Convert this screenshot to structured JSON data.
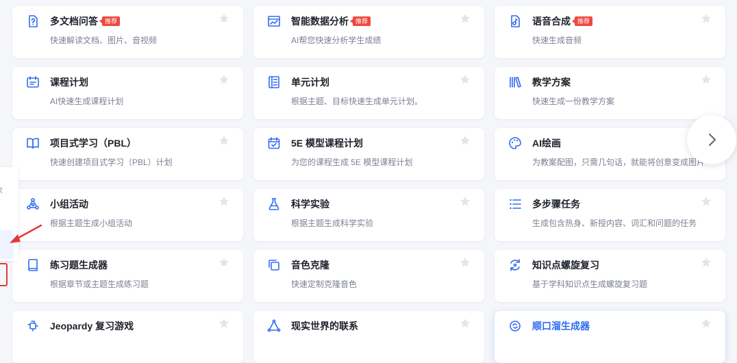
{
  "cards": [
    {
      "title": "多文档问答",
      "desc": "快速解读文档、图片、音视频",
      "badge": "推荐",
      "icon": "doc-question-icon"
    },
    {
      "title": "智能数据分析",
      "desc": "AI帮您快速分析学生成绩",
      "badge": "推荐",
      "icon": "data-chart-icon"
    },
    {
      "title": "语音合成",
      "desc": "快速生成音频",
      "badge": "推荐",
      "icon": "audio-file-icon"
    },
    {
      "title": "课程计划",
      "desc": "AI快速生成课程计划",
      "badge": "",
      "icon": "course-plan-icon"
    },
    {
      "title": "单元计划",
      "desc": "根据主题、目标快速生成单元计划。",
      "badge": "",
      "icon": "unit-plan-icon"
    },
    {
      "title": "教学方案",
      "desc": "快速生成一份教学方案",
      "badge": "",
      "icon": "books-icon"
    },
    {
      "title": "项目式学习（PBL）",
      "desc": "快速创建项目式学习（PBL）计划",
      "badge": "",
      "icon": "open-book-icon"
    },
    {
      "title": "5E 模型课程计划",
      "desc": "为您的课程生成 5E 模型课程计划",
      "badge": "",
      "icon": "calendar-check-icon"
    },
    {
      "title": "AI绘画",
      "desc": "为教案配图，只需几句话，就能将创意变成图片",
      "badge": "",
      "icon": "palette-icon"
    },
    {
      "title": "小组活动",
      "desc": "根据主题生成小组活动",
      "badge": "",
      "icon": "group-network-icon"
    },
    {
      "title": "科学实验",
      "desc": "根据主题生成科学实验",
      "badge": "",
      "icon": "flask-icon"
    },
    {
      "title": "多步骤任务",
      "desc": "生成包含热身、新授内容、词汇和问题的任务",
      "badge": "",
      "icon": "checklist-icon"
    },
    {
      "title": "练习题生成器",
      "desc": "根据章节或主题生成练习题",
      "badge": "",
      "icon": "notebook-icon"
    },
    {
      "title": "音色克隆",
      "desc": "快速定制克隆音色",
      "badge": "",
      "icon": "copy-clone-icon"
    },
    {
      "title": "知识点螺旋复习",
      "desc": "基于学科知识点生成螺旋复习题",
      "badge": "",
      "icon": "spiral-review-icon"
    },
    {
      "title": "Jeopardy 复习游戏",
      "desc": "",
      "badge": "",
      "icon": "puzzle-game-icon"
    },
    {
      "title": "现实世界的联系",
      "desc": "",
      "badge": "",
      "icon": "triangle-nodes-icon"
    },
    {
      "title": "顺口溜生成器",
      "desc": "",
      "badge": "",
      "icon": "rhyme-cycle-icon"
    }
  ],
  "side_panel": {
    "text": "求"
  },
  "colors": {
    "accent": "#2f6bf0",
    "badge": "#f0483e",
    "star": "#e3e5ea",
    "annotation": "#e53935"
  }
}
